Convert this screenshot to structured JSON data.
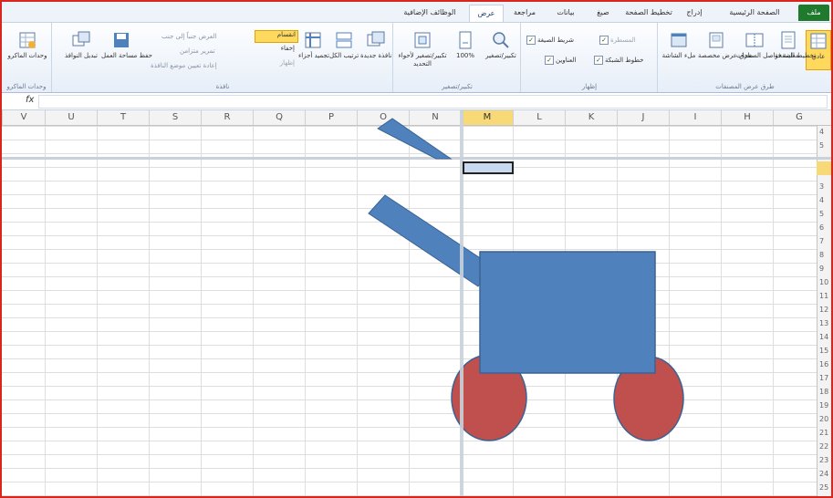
{
  "tabs": [
    {
      "label": "ملف",
      "file": true
    },
    {
      "label": "الصفحة الرئيسية"
    },
    {
      "label": "إدراج"
    },
    {
      "label": "تخطيط الصفحة"
    },
    {
      "label": "صيغ"
    },
    {
      "label": "بيانات"
    },
    {
      "label": "مراجعة"
    },
    {
      "label": "عرض",
      "active": true
    },
    {
      "label": "الوظائف الإضافية"
    }
  ],
  "groups": {
    "workbook_views": {
      "label": "طرق عرض المصنفات",
      "normal": "عادي",
      "page_layout": "تخطيط الصفحة",
      "page_break": "معاينة فواصل الصفحات",
      "custom_views": "طرق عرض مخصصة",
      "full_screen": "ملء الشاشة"
    },
    "show": {
      "label": "إظهار",
      "ruler": "المسطرة",
      "formula_bar": "شريط الصيغة",
      "gridlines": "خطوط الشبكة",
      "headings": "العناوين"
    },
    "zoom": {
      "label": "تكبير/تصغير",
      "zoom": "تكبير/تصغير",
      "hundred": "100%",
      "zoom_selection": "تكبير/تصغير لأحواء التحديد"
    },
    "window": {
      "label": "نافذة",
      "new_window": "نافذة جديدة",
      "arrange_all": "ترتيب الكل",
      "freeze": "تجميد أجزاء",
      "split": "انقسام",
      "hide": "إخفاء",
      "unhide": "إظهار",
      "side_by_side": "العرض جنباً إلى جنب",
      "sync_scroll": "تمرير متزامن",
      "reset_pos": "إعادة تعيين موضع النافذة",
      "save_ws": "حفظ مساحة العمل",
      "switch": "تبديل النوافذ"
    },
    "macros": {
      "label": "وحدات الماكرو",
      "macros": "وحدات الماكرو"
    }
  },
  "formula_bar": {
    "fx": "fx",
    "value": ""
  },
  "columns": [
    "V",
    "U",
    "T",
    "S",
    "R",
    "Q",
    "P",
    "O",
    "N",
    "M",
    "L",
    "K",
    "J",
    "I",
    "H",
    "G"
  ],
  "selected_column": "M",
  "rows": [
    "4",
    "5",
    "",
    "2",
    "3",
    "4",
    "5",
    "6",
    "7",
    "8",
    "9",
    "10",
    "11",
    "12",
    "13",
    "14",
    "15",
    "16",
    "17",
    "18",
    "19",
    "20",
    "21",
    "22",
    "23",
    "24",
    "25"
  ],
  "colors": {
    "shape_fill": "#4f81bd",
    "wheel_fill": "#c0504d",
    "frame": "#d9261c",
    "selection": "#f8d978"
  }
}
